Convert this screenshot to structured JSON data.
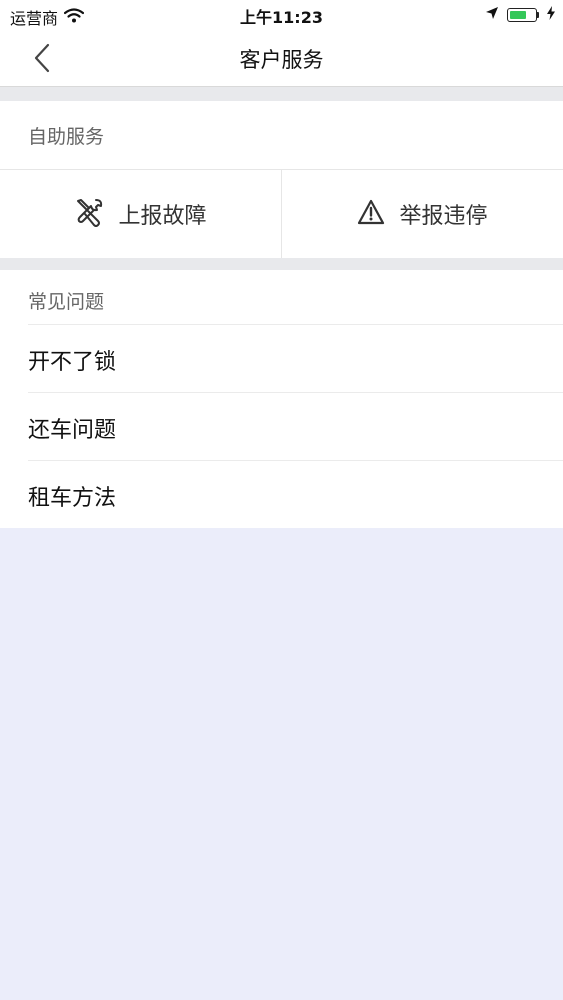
{
  "status_bar": {
    "carrier": "运营商",
    "time": "上午11:23",
    "battery_color": "#34c759",
    "icons": [
      "wifi-icon",
      "location-arrow-icon",
      "battery-icon",
      "charging-bolt-icon"
    ]
  },
  "nav": {
    "title": "客户服务",
    "back_icon": "chevron-left-icon"
  },
  "self_service": {
    "header": "自助服务",
    "actions": [
      {
        "label": "上报故障",
        "icon": "wrench-screwdriver-icon"
      },
      {
        "label": "举报违停",
        "icon": "warning-triangle-icon"
      }
    ]
  },
  "faq": {
    "header": "常见问题",
    "items": [
      {
        "label": "开不了锁"
      },
      {
        "label": "还车问题"
      },
      {
        "label": "租车方法"
      }
    ]
  },
  "colors": {
    "page_background": "#ebedfa",
    "section_gap": "#e8e9ec",
    "card": "#ffffff"
  }
}
